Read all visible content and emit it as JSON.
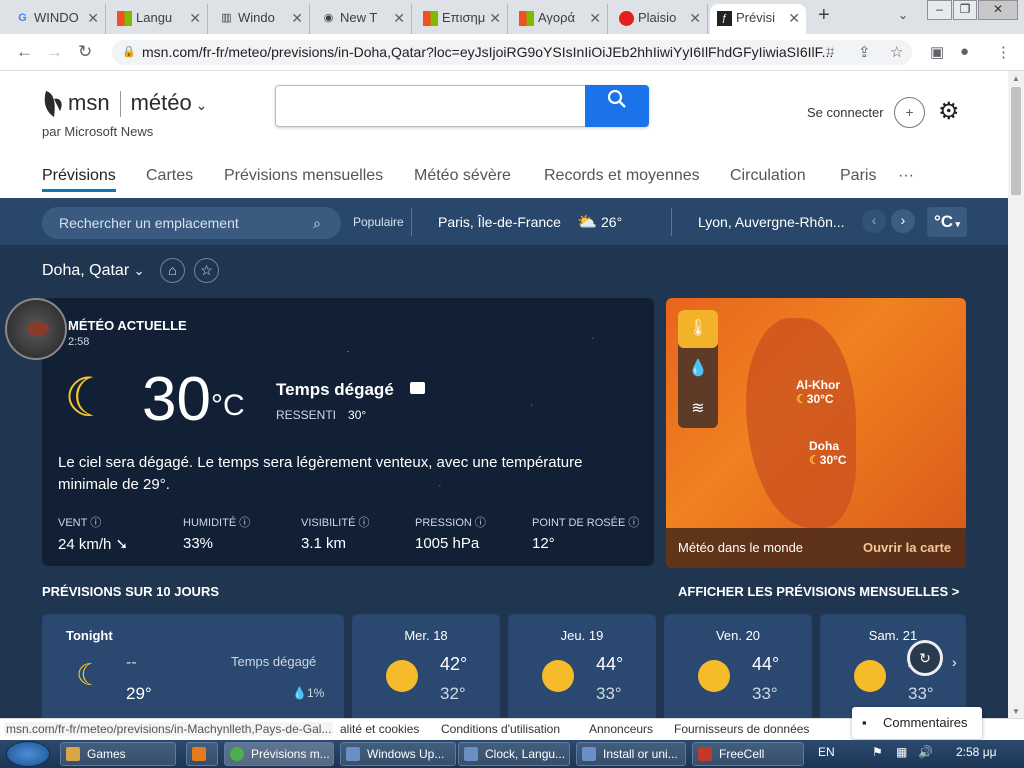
{
  "browser": {
    "tabs": [
      {
        "title": "WINDO",
        "icon": "google-icon"
      },
      {
        "title": "Langu",
        "icon": "microsoft-icon"
      },
      {
        "title": "Windo",
        "icon": "building-icon"
      },
      {
        "title": "New T",
        "icon": "chrome-icon"
      },
      {
        "title": "Επισημ",
        "icon": "microsoft-icon"
      },
      {
        "title": "Αγορά",
        "icon": "microsoft-icon"
      },
      {
        "title": "Plaisio",
        "icon": "plaisio-icon"
      },
      {
        "title": "Prévisi",
        "icon": "msn-icon"
      }
    ],
    "new_tab": "+",
    "url": "msn.com/fr-fr/meteo/previsions/in-Doha,Qatar?loc=eyJsIjoiRG9oYSIsInIiOiJEb2hhIiwiYyI6IlFhdGFyIiwiaSI6IlF..."
  },
  "msn": {
    "brand": "msn",
    "section": "météo",
    "byline": "par Microsoft News",
    "signin": "Se connecter",
    "nav": [
      "Prévisions",
      "Cartes",
      "Prévisions mensuelles",
      "Météo sévère",
      "Records et moyennes",
      "Circulation",
      "Paris",
      "···"
    ]
  },
  "weather": {
    "search_placeholder": "Rechercher un emplacement",
    "popular": "Populaire",
    "cities": [
      {
        "name": "Paris, Île-de-France",
        "temp": "26°"
      },
      {
        "name": "Lyon, Auvergne-Rhôn...",
        "temp": ""
      }
    ],
    "unit": "°C",
    "location": "Doha, Qatar",
    "current": {
      "label": "MÉTÉO ACTUELLE",
      "time": "2:58",
      "temp": "30",
      "unit": "°C",
      "condition": "Temps dégagé",
      "feels_label": "RESSENTI",
      "feels_value": "30°",
      "description": "Le ciel sera dégagé. Le temps sera légèrement venteux, avec une température minimale de 29°.",
      "stats": [
        {
          "label": "VENT",
          "value": "24 km/h"
        },
        {
          "label": "HUMIDITÉ",
          "value": "33%"
        },
        {
          "label": "VISIBILITÉ",
          "value": "3.1 km"
        },
        {
          "label": "PRESSION",
          "value": "1005 hPa"
        },
        {
          "label": "POINT DE ROSÉE",
          "value": "12°"
        }
      ]
    },
    "map": {
      "labels": [
        {
          "name": "Al-Khor",
          "temp": "30°C"
        },
        {
          "name": "Doha",
          "temp": "30°C"
        }
      ],
      "footer_left": "Météo dans le monde",
      "footer_right": "Ouvrir la carte"
    },
    "forecast_title": "PRÉVISIONS SUR 10 JOURS",
    "monthly_link": "AFFICHER LES PRÉVISIONS MENSUELLES >",
    "tonight": {
      "day": "Tonight",
      "high": "--",
      "low": "29°",
      "condition": "Temps dégagé",
      "precip": "1%"
    },
    "days": [
      {
        "day": "Mer. 18",
        "high": "42°",
        "low": "32°"
      },
      {
        "day": "Jeu. 19",
        "high": "44°",
        "low": "33°"
      },
      {
        "day": "Ven. 20",
        "high": "44°",
        "low": "33°"
      },
      {
        "day": "Sam. 21",
        "high": "4",
        "low": "33°"
      }
    ]
  },
  "status": {
    "url": "msn.com/fr-fr/meteo/previsions/in-Machynlleth,Pays-de-Gal...",
    "footer_links": [
      "alité et cookies",
      "Conditions d'utilisation",
      "Annonceurs",
      "Fournisseurs de données"
    ],
    "comments": "Commentaires"
  },
  "taskbar": {
    "items": [
      "Games",
      "Prévisions m...",
      "Windows Up...",
      "Clock, Langu...",
      "Install or uni...",
      "FreeCell"
    ],
    "lang": "EN",
    "time": "2:58 μμ"
  }
}
